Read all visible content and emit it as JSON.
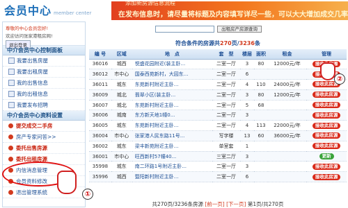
{
  "header": {
    "logo": "会员中心",
    "logo_sub": "member center",
    "notice_top": "添加新房源信息流程",
    "notice": "在发布信息时，请尽量将标题及内容填写详尽一些，可以大大增加成交几率!"
  },
  "user": {
    "hello": "尊敬的中心会员您好!",
    "who": "欢迎访问张家港租房网!",
    "logout": "退出登录"
  },
  "sidebar": {
    "section1": "中介会员中心控制面板",
    "items1": [
      "我要出售房屋",
      "我要出租房屋",
      "我的出售信息",
      "我的出租信息",
      "我要发布招聘"
    ],
    "section2": "中介会员中心资料设置",
    "items2": [
      "提交成交二手房",
      "房产专家问答>>",
      "委托出售房源",
      "委托出租房源",
      "内信消息管理",
      "会员资料修改",
      "退出管理系统"
    ]
  },
  "search": {
    "button": "出租房产房源查询"
  },
  "count": {
    "prefix": "符合条件的房源共",
    "pages": "270",
    "mid": "页/",
    "total": "3236",
    "suffix": "条"
  },
  "table": {
    "headers": [
      "编 号",
      "区域",
      "地　点",
      "套　型",
      "楼层",
      "面积",
      "租金",
      "管理"
    ],
    "rows": [
      [
        "36016",
        "城西",
        "悦盛花园附近(装主卧...",
        "二室一厅",
        "3",
        "80",
        "12000元/年",
        "接收此房源"
      ],
      [
        "36012",
        "市中心",
        "国泰西苑新村，大园东...",
        "二室一厅",
        "6",
        "",
        "",
        "接收此房源"
      ],
      [
        "36011",
        "城东",
        "东苑新村附近主卧...",
        "二室一厅",
        "4",
        "110",
        "24000元/年",
        "接收此房源"
      ],
      [
        "36009",
        "城北",
        "翡翠小区(装主卧...",
        "二室一厅",
        "3",
        "80",
        "12000元/年",
        "接收此房源"
      ],
      [
        "36007",
        "城北",
        "东苑新村附近主卧...",
        "二室一厅",
        "5",
        "68",
        "",
        "接收此房源"
      ],
      [
        "36006",
        "城南",
        "东方新天地1幢0...",
        "二室一厅",
        "3",
        "",
        "",
        "接收此房源"
      ],
      [
        "36005",
        "城东",
        "东苑新村附近主卧...",
        "二室一厅",
        "4",
        "113",
        "22000元/年",
        "接收此房源"
      ],
      [
        "36004",
        "市中心",
        "张家港人民东路11号...",
        "写字楼",
        "13",
        "60",
        "36000元/年",
        "接收此房源"
      ],
      [
        "36002",
        "城东",
        "梁丰新苑附近主卧...",
        "单室套",
        "1",
        "",
        "",
        "接收此房源"
      ],
      [
        "36001",
        "市中心",
        "旺西新村57幢40...",
        "三室二厅",
        "3",
        "",
        "",
        "更新"
      ],
      [
        "35998",
        "城东",
        "南二环路1号附近主卧...",
        "二室一厅",
        "3",
        "",
        "",
        "接收此房源"
      ],
      [
        "35996",
        "城西",
        "暨阳新村附近主卧...",
        "二室一厅",
        "6",
        "",
        "",
        "接收此房源"
      ]
    ]
  },
  "pager": {
    "text": "共270页/3236条房源",
    "prev": "[前一页]",
    "next": "[下一页]",
    "pos": "第1页/共270页"
  },
  "callouts": [
    "①",
    "②"
  ]
}
